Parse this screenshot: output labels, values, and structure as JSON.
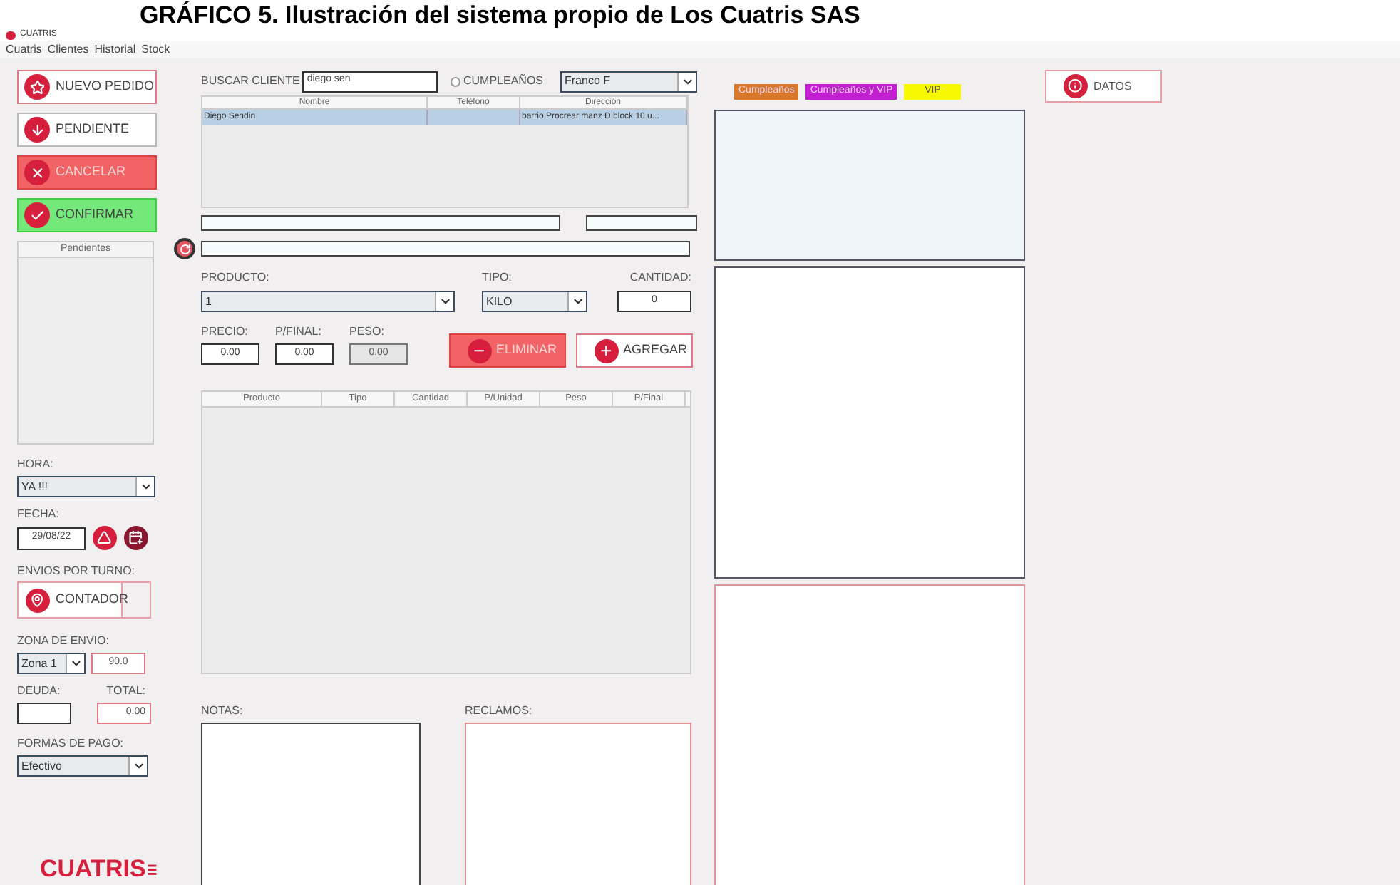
{
  "caption": "GRÁFICO 5. Ilustración del sistema propio de Los Cuatris SAS",
  "window": {
    "title": "CUATRIS"
  },
  "menu": [
    "Cuatris",
    "Clientes",
    "Historial",
    "Stock"
  ],
  "actions": [
    {
      "label": "NUEVO PEDIDO",
      "kind": "outline"
    },
    {
      "label": "PENDIENTE",
      "kind": "plain"
    },
    {
      "label": "CANCELAR",
      "kind": "danger"
    },
    {
      "label": "CONFIRMAR",
      "kind": "success"
    }
  ],
  "pending_list": {
    "header": "Pendientes"
  },
  "hora": {
    "label": "HORA:",
    "value": "YA !!!"
  },
  "fecha": {
    "label": "FECHA:",
    "value": "29/08/22"
  },
  "envios": {
    "label": "ENVIOS POR TURNO:",
    "button": "CONTADOR"
  },
  "zona": {
    "label": "ZONA DE ENVIO:",
    "value": "Zona 1",
    "amount": "90.0"
  },
  "deuda": {
    "label": "DEUDA:"
  },
  "total": {
    "label": "TOTAL:",
    "value": "0.00"
  },
  "pago": {
    "label": "FORMAS DE PAGO:",
    "value": "Efectivo"
  },
  "logo": "CUATRIS",
  "search": {
    "label": "BUSCAR CLIENTE",
    "value": "diego sen",
    "birthday": {
      "label": "CUMPLEAÑOS",
      "selected": false
    },
    "client": "Franco F"
  },
  "clients": {
    "columns": [
      "Nombre",
      "Teléfono",
      "Dirección"
    ],
    "rows": [
      {
        "cells": [
          "Diego Sendin",
          null,
          "barrio Procrear manz D block 10 u..."
        ],
        "selected": true
      }
    ]
  },
  "producto": {
    "label": "PRODUCTO:",
    "value": "1"
  },
  "tipo": {
    "label": "TIPO:",
    "value": "KILO"
  },
  "cantidad": {
    "label": "CANTIDAD:",
    "value": "0"
  },
  "prices": [
    {
      "label": "PRECIO:",
      "value": "0.00",
      "disabled": false
    },
    {
      "label": "P/FINAL:",
      "value": "0.00",
      "disabled": false
    },
    {
      "label": "PESO:",
      "value": "0.00",
      "disabled": true
    }
  ],
  "item_buttons": [
    {
      "label": "ELIMINAR",
      "kind": "danger"
    },
    {
      "label": "AGREGAR",
      "kind": "outline"
    }
  ],
  "items": {
    "columns": [
      "Producto",
      "Tipo",
      "Cantidad",
      "P/Unidad",
      "Peso",
      "P/Final"
    ]
  },
  "notas": {
    "label": "NOTAS:"
  },
  "reclamos": {
    "label": "RECLAMOS:"
  },
  "legend": [
    {
      "label": "Cumpleaños",
      "color": "#d9772a"
    },
    {
      "label": "Cumpleaños y VIP",
      "color": "#c21fd1"
    },
    {
      "label": "VIP",
      "color": "#f7f700"
    }
  ],
  "datos": "DATOS"
}
